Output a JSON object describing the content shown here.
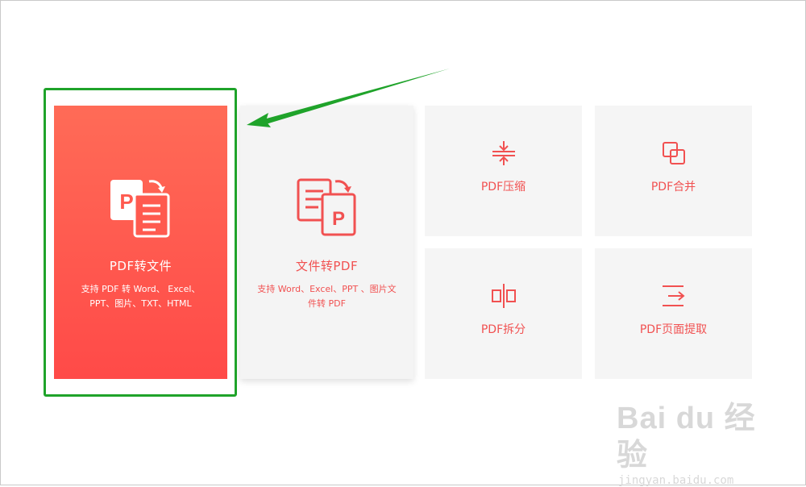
{
  "tools": {
    "pdf_to_file": {
      "title": "PDF转文件",
      "desc_line1": "支持 PDF 转 Word、 Excel、",
      "desc_line2": "PPT、图片、TXT、HTML",
      "icon": "pdf-to-file-icon"
    },
    "file_to_pdf": {
      "title": "文件转PDF",
      "desc_line1": "支持 Word、Excel、PPT 、图片文",
      "desc_line2": "件转 PDF",
      "icon": "file-to-pdf-icon"
    },
    "compress": {
      "title": "PDF压缩",
      "icon": "compress-icon"
    },
    "merge": {
      "title": "PDF合并",
      "icon": "merge-icon"
    },
    "split": {
      "title": "PDF拆分",
      "icon": "split-icon"
    },
    "extract": {
      "title": "PDF页面提取",
      "icon": "page-extract-icon"
    }
  },
  "watermark": {
    "logo": "Bai du 经验",
    "url": "jingyan.baidu.com"
  },
  "colors": {
    "accent": "#f15151",
    "primary_gradient_top": "#ff6b57",
    "primary_gradient_bottom": "#ff4a48",
    "card_bg": "#f5f5f5",
    "highlight": "#1fa32a"
  }
}
